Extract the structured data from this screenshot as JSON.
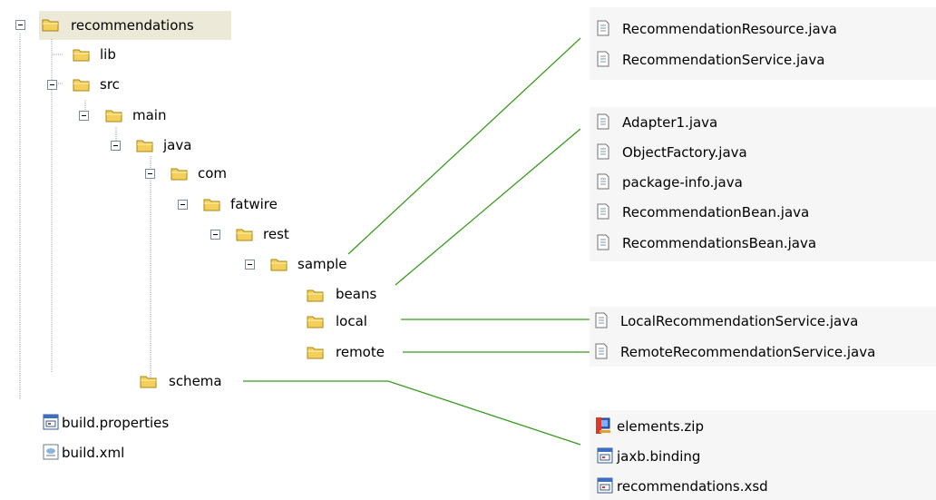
{
  "tree": {
    "root": "recommendations",
    "lib": "lib",
    "src": "src",
    "main": "main",
    "java": "java",
    "com": "com",
    "fatwire": "fatwire",
    "rest": "rest",
    "sample": "sample",
    "beans": "beans",
    "local": "local",
    "remote": "remote",
    "schema": "schema",
    "build_properties": "build.properties",
    "build_xml": "build.xml"
  },
  "groups": {
    "sample_files": [
      "RecommendationResource.java",
      "RecommendationService.java"
    ],
    "beans_files": [
      "Adapter1.java",
      "ObjectFactory.java",
      "package-info.java",
      "RecommendationBean.java",
      "RecommendationsBean.java"
    ],
    "local_files": [
      "LocalRecommendationService.java"
    ],
    "remote_files": [
      "RemoteRecommendationService.java"
    ],
    "schema_files": [
      "elements.zip",
      "jaxb.binding",
      "recommendations.xsd"
    ]
  },
  "colors": {
    "connector": "#3a9a1e",
    "folder_body": "#f4cf5c",
    "folder_border": "#a8840f",
    "tree_line": "#a0a0a0",
    "panel": "#f6f6f6"
  },
  "icons": {
    "folder": "folder-icon",
    "java_file": "java-file-icon",
    "properties_file": "properties-file-icon",
    "xml_file": "xml-file-icon",
    "zip_file": "zip-file-icon"
  }
}
